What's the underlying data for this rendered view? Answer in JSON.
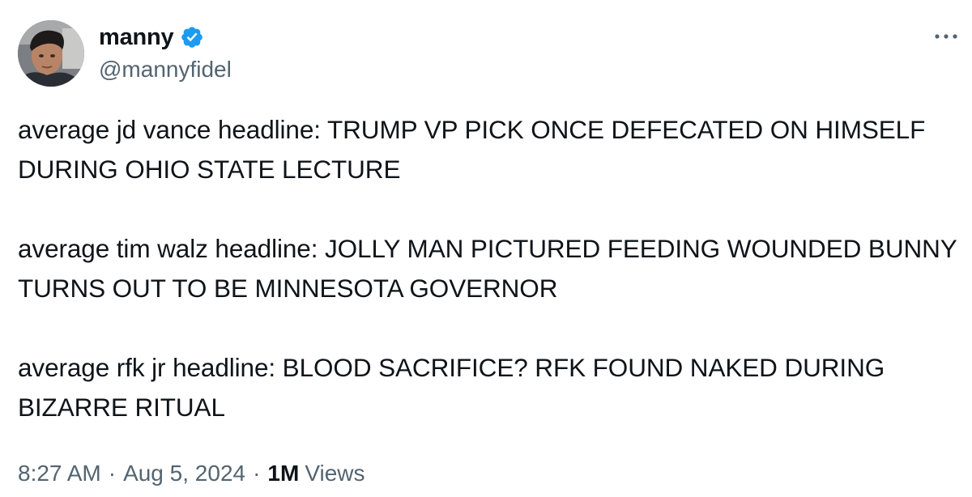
{
  "author": {
    "display_name": "manny",
    "handle": "@mannyfidel",
    "verified": true,
    "avatar_icon": "profile-photo"
  },
  "menu": {
    "more_icon": "more-horizontal-icon"
  },
  "tweet": {
    "paragraphs": [
      "average jd vance headline: TRUMP VP PICK ONCE DEFECATED ON HIMSELF DURING OHIO STATE LECTURE",
      "average tim walz headline: JOLLY MAN PICTURED FEEDING WOUNDED BUNNY TURNS OUT TO BE MINNESOTA GOVERNOR",
      "average rfk jr headline: BLOOD SACRIFICE? RFK FOUND NAKED DURING BIZARRE RITUAL"
    ]
  },
  "meta": {
    "time": "8:27 AM",
    "separator": "·",
    "date": "Aug 5, 2024",
    "views_count": "1M",
    "views_label": "Views"
  },
  "colors": {
    "text_primary": "#0f1419",
    "text_secondary": "#536471",
    "verified_blue": "#1d9bf0",
    "background": "#ffffff"
  }
}
